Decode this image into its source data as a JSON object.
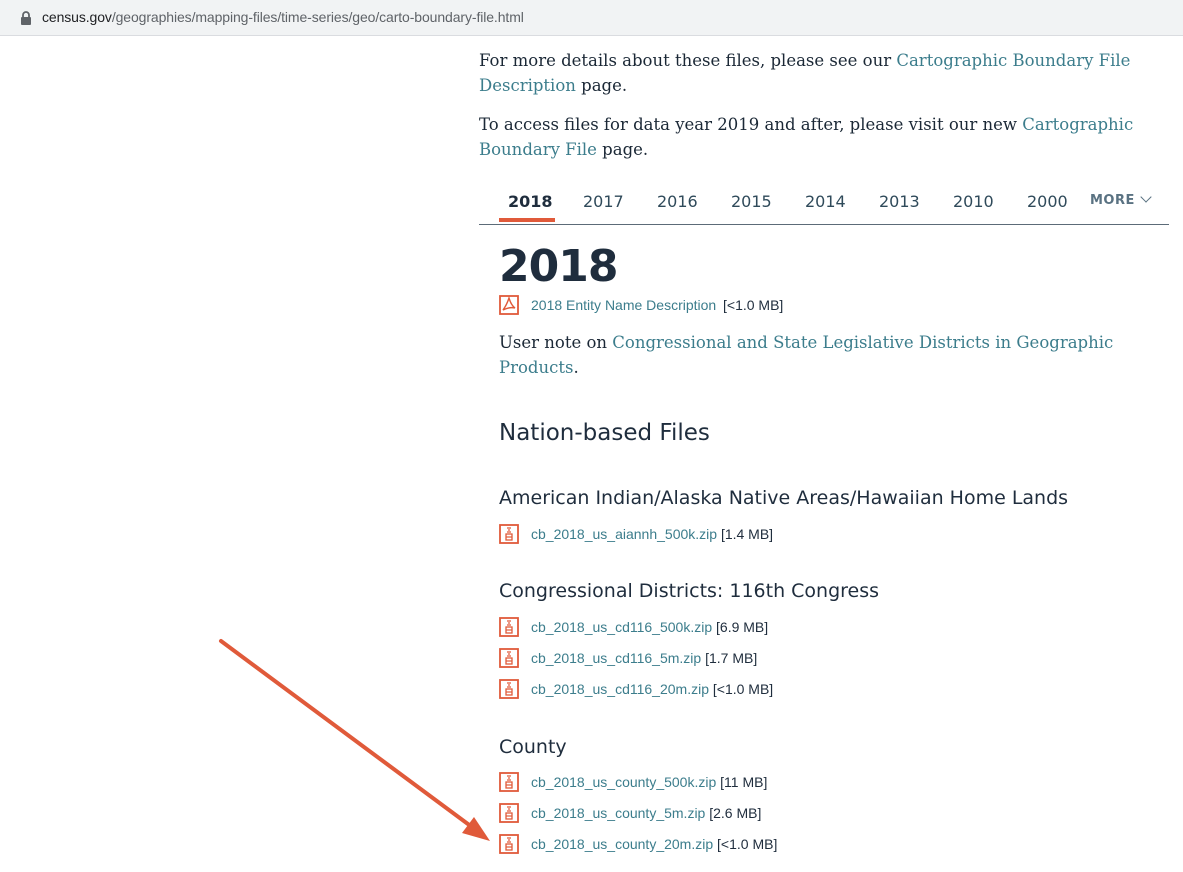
{
  "browser": {
    "url_host": "census.gov",
    "url_path": "/geographies/mapping-files/time-series/geo/carto-boundary-file.html"
  },
  "intro": {
    "p1_before": "For more details about these files, please see our ",
    "p1_link": "Cartographic Boundary File Description",
    "p1_after": " page.",
    "p2_before": "To access files for data year 2019 and after, please visit our new ",
    "p2_link": "Cartographic Boundary File",
    "p2_after": " page."
  },
  "tabs": {
    "items": [
      "2018",
      "2017",
      "2016",
      "2015",
      "2014",
      "2013",
      "2010",
      "2000"
    ],
    "active": "2018",
    "more_label": "MORE"
  },
  "section": {
    "year_heading": "2018",
    "entity_file": {
      "name": "2018 Entity Name Description",
      "size": "[<1.0 MB]",
      "icon": "pdf-icon"
    },
    "note_before": "User note on ",
    "note_link": "Congressional and State Legislative Districts in Geographic Products",
    "note_after": ".",
    "nation_heading": "Nation-based Files",
    "groups": [
      {
        "title": "American Indian/Alaska Native Areas/Hawaiian Home Lands",
        "files": [
          {
            "name": "cb_2018_us_aiannh_500k.zip",
            "size": "[1.4 MB]"
          }
        ]
      },
      {
        "title": "Congressional Districts: 116th Congress",
        "files": [
          {
            "name": "cb_2018_us_cd116_500k.zip",
            "size": "[6.9 MB]"
          },
          {
            "name": "cb_2018_us_cd116_5m.zip",
            "size": "[1.7 MB]"
          },
          {
            "name": "cb_2018_us_cd116_20m.zip",
            "size": "[<1.0 MB]"
          }
        ]
      },
      {
        "title": "County",
        "files": [
          {
            "name": "cb_2018_us_county_500k.zip",
            "size": "[11 MB]"
          },
          {
            "name": "cb_2018_us_county_5m.zip",
            "size": "[2.6 MB]"
          },
          {
            "name": "cb_2018_us_county_20m.zip",
            "size": "[<1.0 MB]"
          }
        ]
      }
    ]
  },
  "colors": {
    "link": "#3c7d8c",
    "icon": "#e05a3a",
    "annotation_arrow": "#e05a3a",
    "text": "#1f2d3d"
  }
}
